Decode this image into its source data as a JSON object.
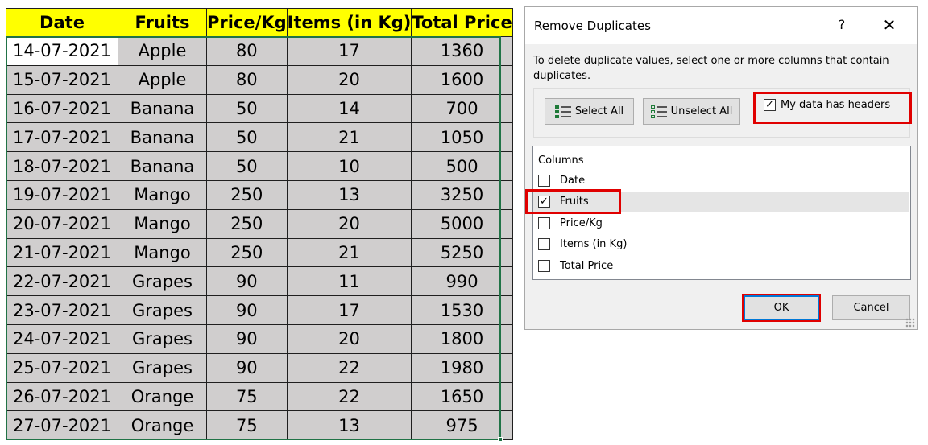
{
  "sheet": {
    "headers": [
      "Date",
      "Fruits",
      "Price/Kg",
      "Items (in Kg)",
      "Total Price"
    ],
    "rows": [
      [
        "14-07-2021",
        "Apple",
        "80",
        "17",
        "1360"
      ],
      [
        "15-07-2021",
        "Apple",
        "80",
        "20",
        "1600"
      ],
      [
        "16-07-2021",
        "Banana",
        "50",
        "14",
        "700"
      ],
      [
        "17-07-2021",
        "Banana",
        "50",
        "21",
        "1050"
      ],
      [
        "18-07-2021",
        "Banana",
        "50",
        "10",
        "500"
      ],
      [
        "19-07-2021",
        "Mango",
        "250",
        "13",
        "3250"
      ],
      [
        "20-07-2021",
        "Mango",
        "250",
        "20",
        "5000"
      ],
      [
        "21-07-2021",
        "Mango",
        "250",
        "21",
        "5250"
      ],
      [
        "22-07-2021",
        "Grapes",
        "90",
        "11",
        "990"
      ],
      [
        "23-07-2021",
        "Grapes",
        "90",
        "17",
        "1530"
      ],
      [
        "24-07-2021",
        "Grapes",
        "90",
        "20",
        "1800"
      ],
      [
        "25-07-2021",
        "Grapes",
        "90",
        "22",
        "1980"
      ],
      [
        "26-07-2021",
        "Orange",
        "75",
        "22",
        "1650"
      ],
      [
        "27-07-2021",
        "Orange",
        "75",
        "13",
        "975"
      ]
    ],
    "colors": {
      "header_fill": "#ffff00",
      "cell_fill": "#d0cece",
      "selection_border": "#217346"
    }
  },
  "dialog": {
    "title": "Remove Duplicates",
    "help_glyph": "?",
    "close_glyph": "✕",
    "instructions": "To delete duplicate values, select one or more columns that contain duplicates.",
    "select_all_label": "Select All",
    "unselect_all_label": "Unselect All",
    "headers_checkbox": {
      "label": "My data has headers",
      "checked": true
    },
    "columns_header": "Columns",
    "columns": [
      {
        "label": "Date",
        "checked": false,
        "selected": false
      },
      {
        "label": "Fruits",
        "checked": true,
        "selected": true
      },
      {
        "label": "Price/Kg",
        "checked": false,
        "selected": false
      },
      {
        "label": "Items (in Kg)",
        "checked": false,
        "selected": false
      },
      {
        "label": "Total Price",
        "checked": false,
        "selected": false
      }
    ],
    "ok_label": "OK",
    "cancel_label": "Cancel",
    "highlight_color": "#e00000",
    "icons": {
      "select_all": "select-all-icon",
      "unselect_all": "unselect-all-icon",
      "check": "✓"
    }
  }
}
